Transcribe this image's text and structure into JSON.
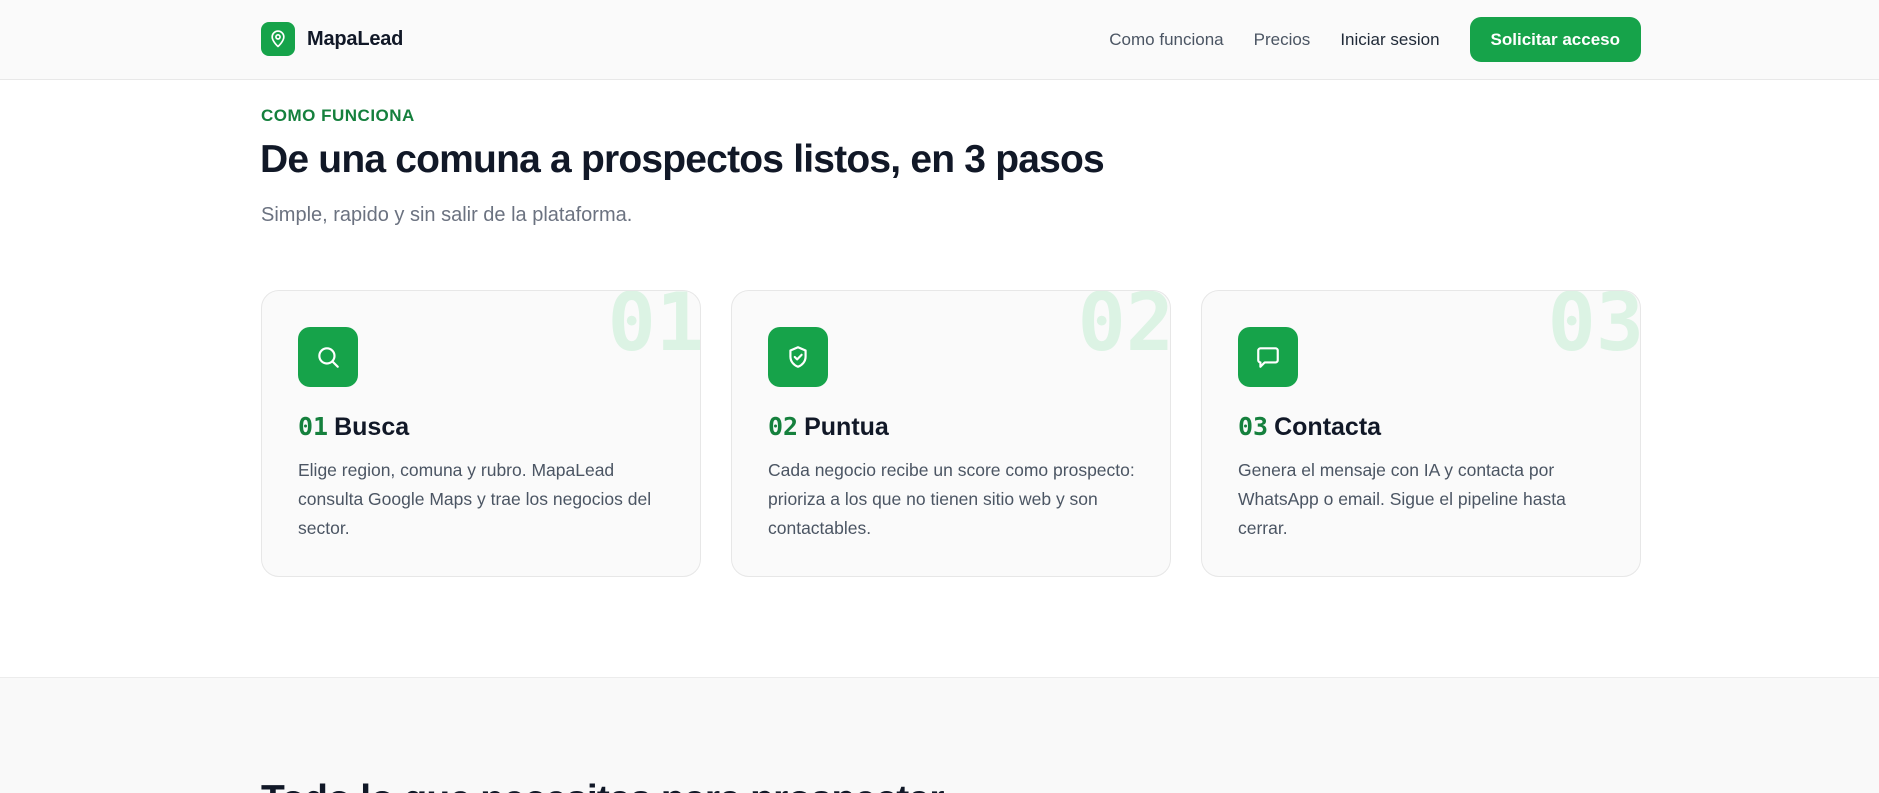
{
  "brand": {
    "name": "MapaLead",
    "logo_icon": "map-pin-icon",
    "accent": "#16a34a"
  },
  "nav": {
    "how_it_works": "Como funciona",
    "pricing": "Precios",
    "login": "Iniciar sesion",
    "cta": "Solicitar acceso"
  },
  "section": {
    "eyebrow": "COMO FUNCIONA",
    "title": "De una comuna a prospectos listos, en 3 pasos",
    "subtitle": "Simple, rapido y sin salir de la plataforma."
  },
  "steps": [
    {
      "number": "01",
      "title": "Busca",
      "icon": "search-icon",
      "description": "Elige region, comuna y rubro. MapaLead consulta Google Maps y trae los negocios del sector."
    },
    {
      "number": "02",
      "title": "Puntua",
      "icon": "shield-check-icon",
      "description": "Cada negocio recibe un score como prospecto: prioriza a los que no tienen sitio web y son contactables."
    },
    {
      "number": "03",
      "title": "Contacta",
      "icon": "chat-icon",
      "description": "Genera el mensaje con IA y contacta por WhatsApp o email. Sigue el pipeline hasta cerrar."
    }
  ],
  "next_section": {
    "heading": "Todo lo que necesitas para prospectar"
  }
}
